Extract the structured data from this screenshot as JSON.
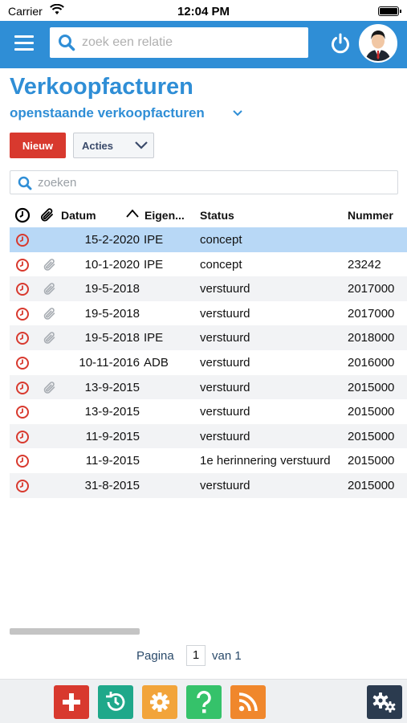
{
  "status_bar": {
    "carrier": "Carrier",
    "time": "12:04 PM"
  },
  "header": {
    "search_placeholder": "zoek een relatie"
  },
  "page": {
    "title": "Verkoopfacturen",
    "subtitle": "openstaande verkoopfacturen"
  },
  "toolbar": {
    "new_label": "Nieuw",
    "actions_label": "Acties"
  },
  "filter": {
    "placeholder": "zoeken"
  },
  "table": {
    "columns": [
      "Datum",
      "Eigen...",
      "Status",
      "Nummer"
    ],
    "rows": [
      {
        "date": "15-2-2020",
        "owner": "IPE",
        "status": "concept",
        "number": "",
        "attachment": false,
        "selected": true
      },
      {
        "date": "10-1-2020",
        "owner": "IPE",
        "status": "concept",
        "number": "23242",
        "attachment": true,
        "selected": false
      },
      {
        "date": "19-5-2018",
        "owner": "",
        "status": "verstuurd",
        "number": "2017000",
        "attachment": true,
        "selected": false
      },
      {
        "date": "19-5-2018",
        "owner": "",
        "status": "verstuurd",
        "number": "2017000",
        "attachment": true,
        "selected": false
      },
      {
        "date": "19-5-2018",
        "owner": "IPE",
        "status": "verstuurd",
        "number": "2018000",
        "attachment": true,
        "selected": false
      },
      {
        "date": "10-11-2016",
        "owner": "ADB",
        "status": "verstuurd",
        "number": "2016000",
        "attachment": false,
        "selected": false
      },
      {
        "date": "13-9-2015",
        "owner": "",
        "status": "verstuurd",
        "number": "2015000",
        "attachment": true,
        "selected": false
      },
      {
        "date": "13-9-2015",
        "owner": "",
        "status": "verstuurd",
        "number": "2015000",
        "attachment": false,
        "selected": false
      },
      {
        "date": "11-9-2015",
        "owner": "",
        "status": "verstuurd",
        "number": "2015000",
        "attachment": false,
        "selected": false
      },
      {
        "date": "11-9-2015",
        "owner": "",
        "status": "1e herinnering verstuurd",
        "number": "2015000",
        "attachment": false,
        "selected": false
      },
      {
        "date": "31-8-2015",
        "owner": "",
        "status": "verstuurd",
        "number": "2015000",
        "attachment": false,
        "selected": false
      }
    ]
  },
  "pagination": {
    "page_label": "Pagina",
    "current_page": "1",
    "of_label": "van 1"
  },
  "bottom_bar": {
    "tiles": [
      {
        "icon": "plus-icon",
        "color": "#d8392e"
      },
      {
        "icon": "history-icon",
        "color": "#1fa88a"
      },
      {
        "icon": "gear-icon",
        "color": "#f2a43a"
      },
      {
        "icon": "help-icon",
        "color": "#35c26a"
      },
      {
        "icon": "rss-icon",
        "color": "#f0872c"
      },
      {
        "icon": "settings-gears-icon",
        "color": "#2b3b4f"
      }
    ]
  },
  "colors": {
    "accent": "#2f8ed6",
    "danger": "#d8392e",
    "selected_row": "#b8d8f6"
  }
}
